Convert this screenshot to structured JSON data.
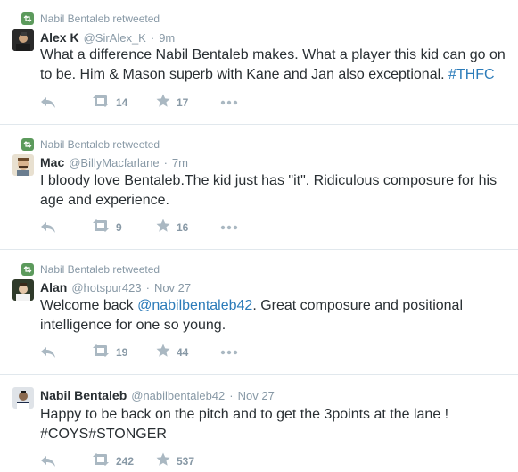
{
  "tweets": [
    {
      "retweeted_by": "Nabil Bentaleb retweeted",
      "name": "Alex K",
      "handle": "@SirAlex_K",
      "time": "9m",
      "text_lines": [
        "What a difference Nabil Bentaleb makes. What a player this kid can go on",
        "to be. Him & Mason superb with Kane and Jan also exceptional. "
      ],
      "hashtag": "#THFC",
      "retweets": "14",
      "favorites": "17"
    },
    {
      "retweeted_by": "Nabil Bentaleb retweeted",
      "name": "Mac",
      "handle": "@BillyMacfarlane",
      "time": "7m",
      "text_lines": [
        "I bloody love Bentaleb.The kid just has \"it\". Ridiculous composure for his",
        "age and experience."
      ],
      "retweets": "9",
      "favorites": "16"
    },
    {
      "retweeted_by": "Nabil Bentaleb retweeted",
      "name": "Alan",
      "handle": "@hotspur423",
      "time": "Nov 27",
      "text_prefix": "Welcome back ",
      "mention": "@nabilbentaleb42",
      "text_suffix": ". Great composure and positional",
      "text_line2": "intelligence for one so young.",
      "retweets": "19",
      "favorites": "44"
    },
    {
      "name": "Nabil Bentaleb",
      "handle": "@nabilbentaleb42",
      "time": "Nov 27",
      "text_lines": [
        "Happy to be back on the pitch and to get the 3points at the lane !",
        "#COYS#STONGER"
      ],
      "retweets": "242",
      "favorites": "537"
    }
  ],
  "separator": "·",
  "colors": {
    "text": "#292f33",
    "muted": "#8899a6",
    "link": "#2b7bb9",
    "border": "#e1e8ed",
    "retweet_badge": "#5c9a5c"
  },
  "icons": [
    "retweet-badge-icon",
    "reply-icon",
    "retweet-icon",
    "favorite-star-icon",
    "more-dots-icon"
  ]
}
